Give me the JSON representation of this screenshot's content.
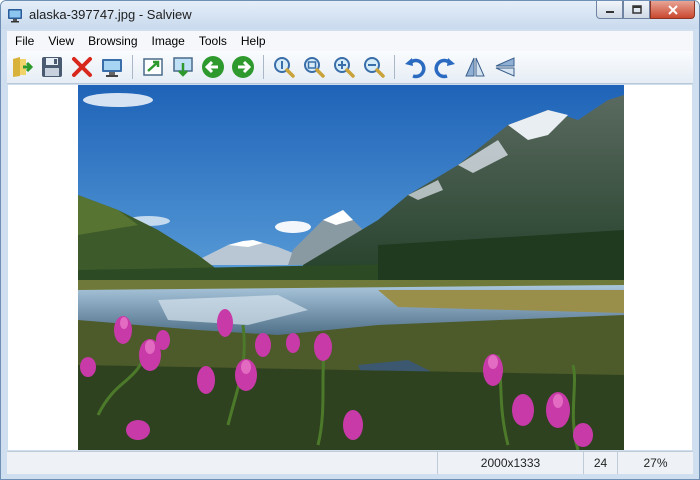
{
  "window": {
    "title": "alaska-397747.jpg - Salview"
  },
  "menu": [
    "File",
    "View",
    "Browsing",
    "Image",
    "Tools",
    "Help"
  ],
  "toolbar": [
    {
      "name": "open-icon"
    },
    {
      "name": "save-icon"
    },
    {
      "name": "delete-icon"
    },
    {
      "name": "monitor-icon"
    },
    {
      "name": "export-icon"
    },
    {
      "name": "wallpaper-icon"
    },
    {
      "name": "previous-icon"
    },
    {
      "name": "next-icon"
    },
    {
      "name": "zoom-icon"
    },
    {
      "name": "fit-icon"
    },
    {
      "name": "zoom-in-icon"
    },
    {
      "name": "zoom-out-icon"
    },
    {
      "name": "rotate-left-icon"
    },
    {
      "name": "rotate-right-icon"
    },
    {
      "name": "flip-horizontal-icon"
    },
    {
      "name": "flip-vertical-icon"
    }
  ],
  "status": {
    "dimensions": "2000x1333",
    "bit_depth": "24",
    "zoom": "27%"
  },
  "colors": {
    "accent": "#4a7ab8",
    "next_green": "#2e9a2e"
  }
}
